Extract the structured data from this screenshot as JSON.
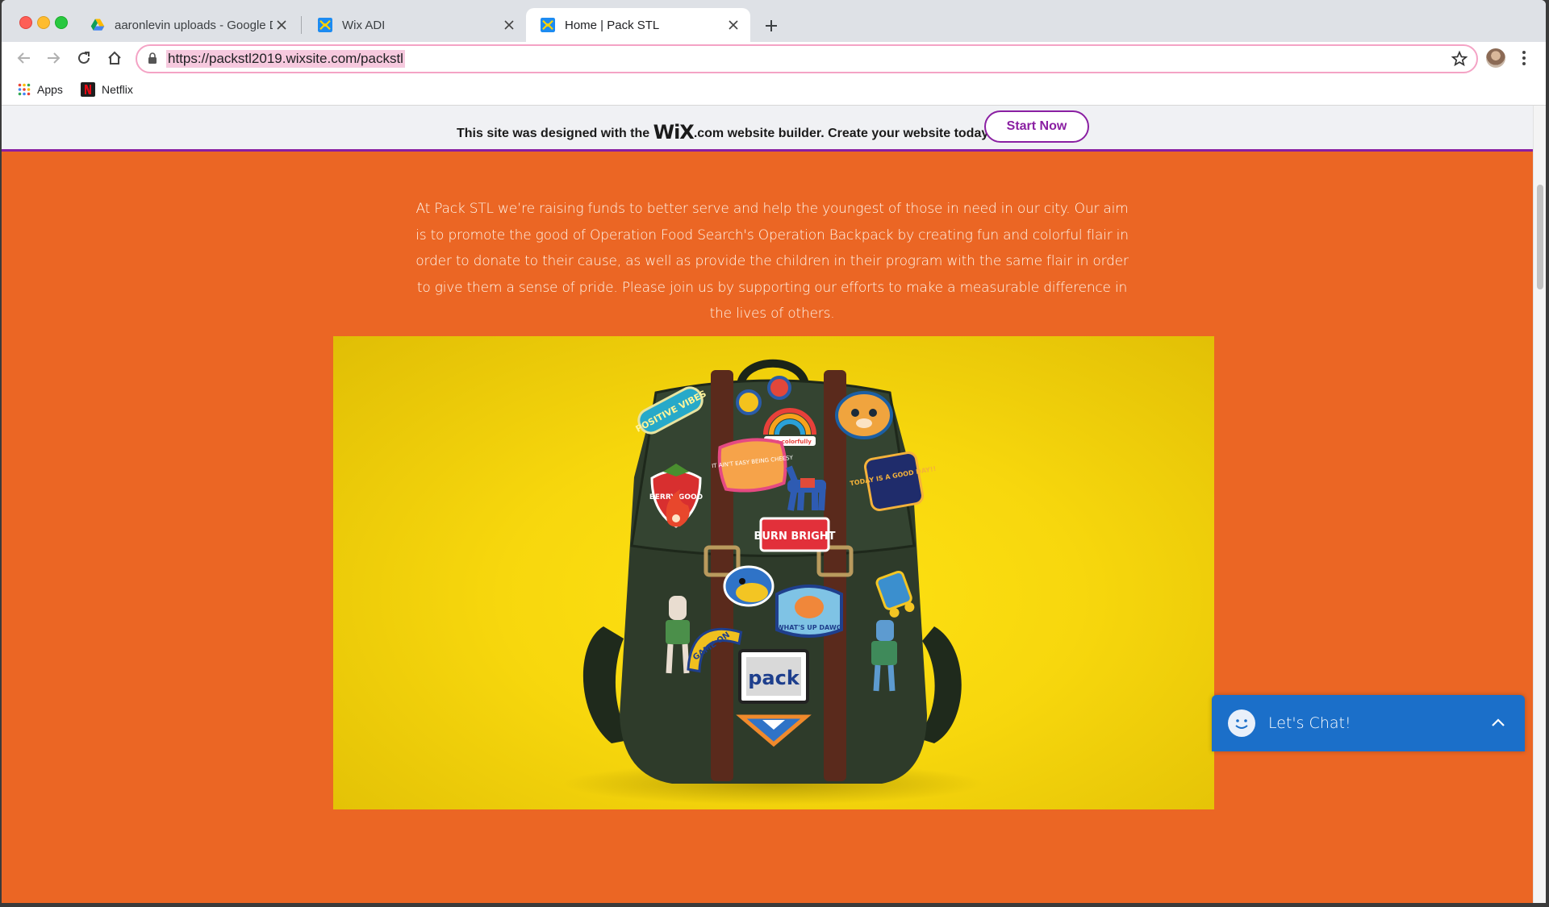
{
  "browser": {
    "tabs": [
      {
        "title": "aaronlevin uploads - Google Drive",
        "icon": "google-drive-icon",
        "active": false
      },
      {
        "title": "Wix ADI",
        "icon": "wix-icon",
        "active": false
      },
      {
        "title": "Home | Pack STL",
        "icon": "wix-icon",
        "active": true
      }
    ],
    "url": "https://packstl2019.wixsite.com/packstl",
    "bookmarks": [
      {
        "label": "Apps",
        "icon": "apps-grid-icon"
      },
      {
        "label": "Netflix",
        "icon": "netflix-icon"
      }
    ]
  },
  "wix_banner": {
    "text_before": "This site was designed with the",
    "logo": "WiX",
    "text_after": ".com website builder. Create your website today.",
    "cta": "Start Now",
    "accent": "#8a1fa2"
  },
  "site": {
    "background": "#eb6624",
    "intro": "At Pack STL we’re raising funds to better serve and help the youngest of those in need in our city. Our aim is to promote the good of Operation Food Search's Operation Backpack by creating fun and colorful flair in order to donate to their cause, as well as provide the children in their program with the same flair in order to give them a sense of pride. Please join us by supporting our efforts to make a measurable difference in the lives of others.",
    "hero_patches": {
      "positive_vibes": "POSITIVE VIBES",
      "live_colorfully": "live colorfully",
      "aint_easy": "IT AIN'T EASY BEING CHEESY",
      "berry_good": "BERRY GOOD",
      "today_good_day": "TODAY IS A GOOD DAY!!",
      "burn_bright": "BURN BRIGHT",
      "whats_dawg": "WHAT'S UP DAWG",
      "game_on": "GAME ON",
      "pack": "pack"
    }
  },
  "chat": {
    "label": "Let's Chat!",
    "color": "#1b6fc9"
  }
}
